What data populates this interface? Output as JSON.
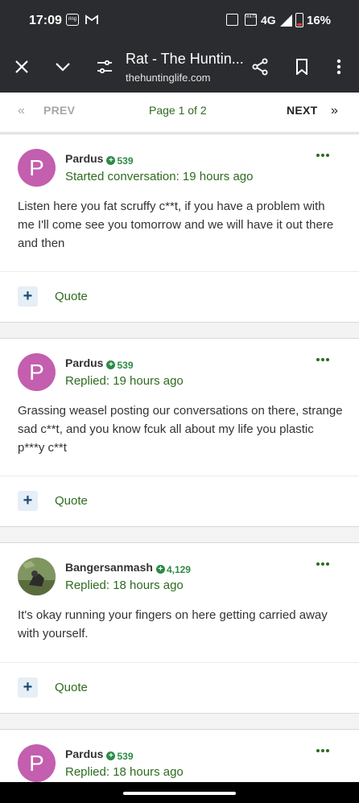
{
  "status_bar": {
    "time": "17:09",
    "ring_label": "ring",
    "network": "4G",
    "battery": "16%",
    "lte_label": "VoLTE"
  },
  "browser": {
    "title": "Rat - The Huntin...",
    "url": "thehuntinglife.com",
    "icons": [
      "close-icon",
      "chevron-down-icon",
      "tune-icon",
      "share-icon",
      "bookmark-icon",
      "more-vert-icon"
    ]
  },
  "pager": {
    "prev": "PREV",
    "page_info": "Page 1 of 2",
    "next": "NEXT",
    "prev_icon": "«",
    "next_icon": "»"
  },
  "posts": [
    {
      "avatar_letter": "P",
      "author": "Pardus",
      "rep": "539",
      "meta": "Started conversation: 19 hours ago",
      "body": "Listen here you fat scruffy c**t, if you have a problem with me I'll come see you tomorrow and we will have it out there and then",
      "quote": "Quote"
    },
    {
      "avatar_letter": "P",
      "author": "Pardus",
      "rep": "539",
      "meta": "Replied: 19 hours ago",
      "body": "Grassing weasel posting our conversations on there, strange sad c**t, and you know fcuk all about my life you plastic p***y c**t",
      "quote": "Quote"
    },
    {
      "avatar_letter": "",
      "author": "Bangersanmash",
      "rep": "4,129",
      "meta": "Replied: 18 hours ago",
      "body": "It's okay running your fingers on here getting carried away with yourself.",
      "quote": "Quote"
    },
    {
      "avatar_letter": "P",
      "author": "Pardus",
      "rep": "539",
      "meta": "Replied: 18 hours ago",
      "body": "",
      "quote": ""
    }
  ],
  "colors": {
    "toolbar": "#2b2c2f",
    "link_green": "#2e6b1f",
    "rep_green": "#2e8a47",
    "avatar_pink": "#c45eae"
  }
}
